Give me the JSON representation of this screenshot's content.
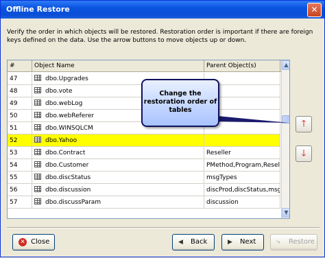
{
  "window": {
    "title": "Offline Restore",
    "close_glyph": "✕"
  },
  "description": "Verify the order in which objects will be restored. Restoration order is important if there are foreign keys defined on the data. Use the arrow buttons to move objects up or down.",
  "table": {
    "columns": [
      "#",
      "Object Name",
      "Parent Object(s)"
    ],
    "rows": [
      {
        "num": "47",
        "name": "dbo.Upgrades",
        "parent": ""
      },
      {
        "num": "48",
        "name": "dbo.vote",
        "parent": ""
      },
      {
        "num": "49",
        "name": "dbo.webLog",
        "parent": ""
      },
      {
        "num": "50",
        "name": "dbo.webReferer",
        "parent": ""
      },
      {
        "num": "51",
        "name": "dbo.WINSQLCM",
        "parent": ""
      },
      {
        "num": "52",
        "name": "dbo.Yahoo",
        "parent": ""
      },
      {
        "num": "53",
        "name": "dbo.Contract",
        "parent": "Reseller"
      },
      {
        "num": "54",
        "name": "dbo.Customer",
        "parent": "PMethod,Program,Reseller"
      },
      {
        "num": "55",
        "name": "dbo.discStatus",
        "parent": "msgTypes"
      },
      {
        "num": "56",
        "name": "dbo.discussion",
        "parent": "discProd,discStatus,msgT"
      },
      {
        "num": "57",
        "name": "dbo.discussParam",
        "parent": "discussion"
      }
    ],
    "selected_row": "52",
    "scroll_up": "▲",
    "scroll_down": "▼"
  },
  "callout": {
    "text": "Change the restoration order of tables"
  },
  "move_buttons": {
    "up_glyph": "🡑",
    "down_glyph": "🡓"
  },
  "footer": {
    "close": "Close",
    "back": "Back",
    "next": "Next",
    "restore": "Restore"
  },
  "colors": {
    "selected_row": "#ffff00",
    "title_bar": "#0a54e0",
    "arrow": "#cc0000"
  }
}
